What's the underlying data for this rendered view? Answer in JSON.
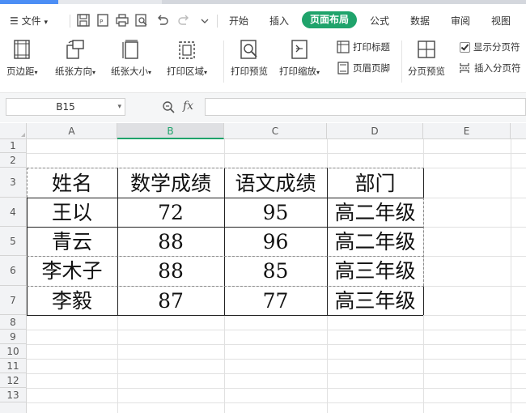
{
  "menu": {
    "file": "文件",
    "tabs": [
      "开始",
      "插入",
      "页面布局",
      "公式",
      "数据",
      "审阅",
      "视图"
    ],
    "active_tab": "页面布局"
  },
  "ribbon": {
    "margins": "页边距",
    "orientation": "纸张方向",
    "size": "纸张大小",
    "print_area": "打印区域",
    "print_preview": "打印预览",
    "print_scale": "打印缩放",
    "print_titles": "打印标题",
    "header_footer": "页眉页脚",
    "page_break_preview": "分页预览",
    "show_page_breaks": "显示分页符",
    "insert_page_break": "插入分页符"
  },
  "formula_bar": {
    "cell_ref": "B15",
    "fx": "fx",
    "value": ""
  },
  "grid": {
    "columns": [
      "A",
      "B",
      "C",
      "D",
      "E"
    ],
    "selected_column": "B",
    "rows": [
      "1",
      "2",
      "3",
      "4",
      "5",
      "6",
      "7",
      "8",
      "9",
      "10",
      "11",
      "12",
      "13"
    ]
  },
  "table": {
    "headers": [
      "姓名",
      "数学成绩",
      "语文成绩",
      "部门"
    ],
    "rows": [
      [
        "王以",
        "72",
        "95",
        "高二年级"
      ],
      [
        "青云",
        "88",
        "96",
        "高二年级"
      ],
      [
        "李木子",
        "88",
        "85",
        "高三年级"
      ],
      [
        "李毅",
        "87",
        "77",
        "高三年级"
      ]
    ]
  },
  "colors": {
    "accent": "#1fa36b",
    "header_bg": "#f2f3f5",
    "selected_header": "#dfe0e3"
  }
}
